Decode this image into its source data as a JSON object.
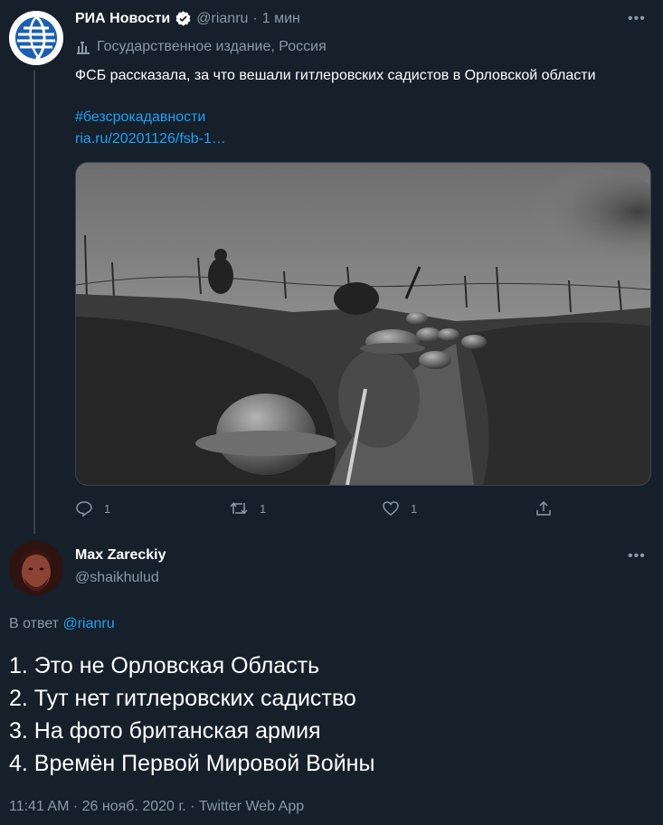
{
  "tweet": {
    "author_name": "РИА Новости",
    "handle": "@rianru",
    "separator": "·",
    "time": "1 мин",
    "label": "Государственное издание, Россия",
    "text": "ФСБ рассказала, за что вешали гитлеровских садистов в Орловской области",
    "hashtag": "#безсрокадавности",
    "url": "ria.ru/20201126/fsb-1…",
    "more": "•••",
    "actions": {
      "reply_count": "1",
      "retweet_count": "1",
      "like_count": "1"
    },
    "colors": {
      "verified": "#ffffff",
      "link": "#1da1f2",
      "avatar_logo": "#1a5fb4"
    }
  },
  "reply": {
    "author_name": "Max Zareckiy",
    "handle": "@shaikhulud",
    "more": "•••",
    "in_reply_prefix": "В ответ",
    "in_reply_handle": "@rianru",
    "lines": [
      "1. Это не Орловская Область",
      "2. Тут нет гитлеровских садиство",
      "3. На фото британская армия",
      "4. Времён Первой Мировой Войны"
    ],
    "meta": "11:41 AM · 26 нояб. 2020 г. · Twitter Web App"
  },
  "icons": {
    "verified": "verified-badge-icon",
    "label": "government-building-icon",
    "reply": "reply-icon",
    "retweet": "retweet-icon",
    "like": "heart-icon",
    "share": "share-icon"
  }
}
